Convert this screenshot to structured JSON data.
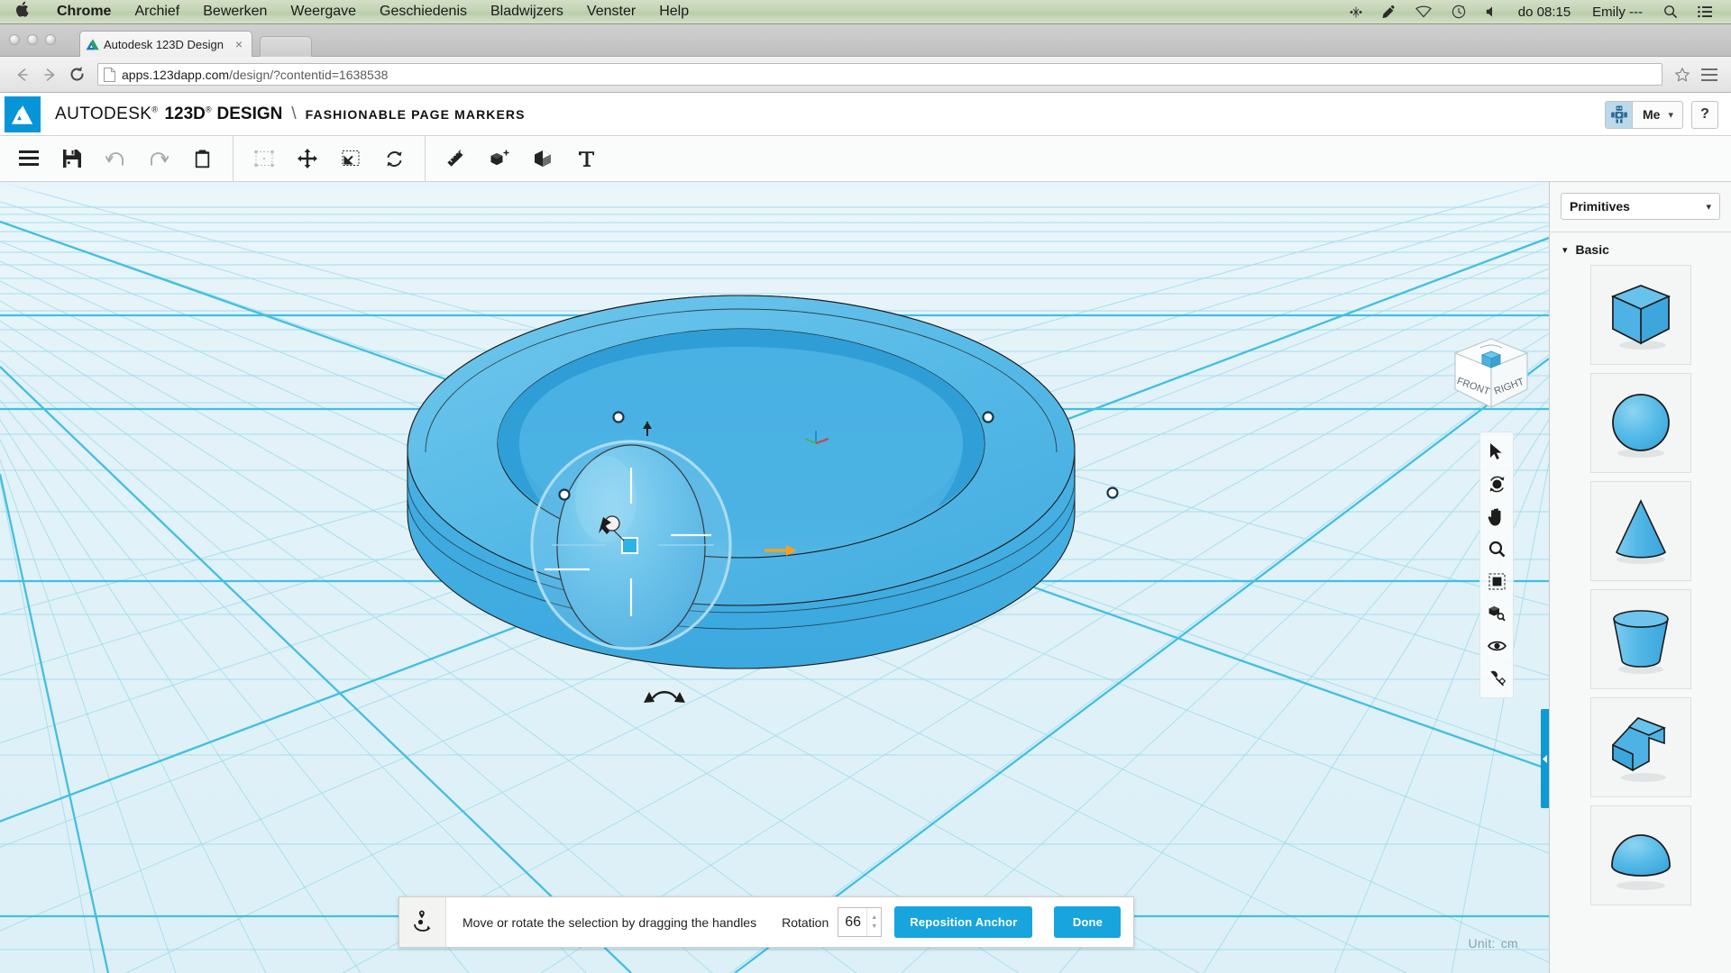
{
  "macmenu": {
    "apple_icon": "apple-icon",
    "items": [
      "Chrome",
      "Archief",
      "Bewerken",
      "Weergave",
      "Geschiedenis",
      "Bladwijzers",
      "Venster",
      "Help"
    ],
    "status": {
      "icons": [
        "bluetooth-icon",
        "pen-icon",
        "wifi-icon",
        "timemachine-icon",
        "volume-icon"
      ],
      "clock": "do 08:15",
      "user": "Emily ---",
      "search_icon": "search-icon",
      "notifications_icon": "list-icon"
    }
  },
  "browser": {
    "tab": {
      "title": "Autodesk 123D Design",
      "close_icon": "close-icon",
      "favicon": "autodesk-favicon"
    },
    "nav": {
      "back_icon": "arrow-left-icon",
      "forward_icon": "arrow-right-icon",
      "reload_icon": "reload-icon"
    },
    "omnibox": {
      "page_icon": "page-icon",
      "url_host": "apps.123dapp.com",
      "url_path": "/design/?contentid=1638538",
      "star_icon": "star-icon"
    },
    "menu_icon": "hamburger-menu-icon"
  },
  "app_header": {
    "logo": "autodesk-logo",
    "brand_autodesk": "AUTODESK",
    "brand_123d": "123D",
    "brand_design": "DESIGN",
    "separator": "\\",
    "document_title": "FASHIONABLE PAGE MARKERS",
    "me_label": "Me",
    "me_chevron": "chevron-down-icon",
    "avatar_icon": "robot-avatar-icon",
    "help_label": "?"
  },
  "toolbar": {
    "groups": [
      [
        {
          "name": "menu-icon",
          "label": "Menu"
        },
        {
          "name": "save-icon",
          "label": "Save"
        },
        {
          "name": "undo-icon",
          "label": "Undo"
        },
        {
          "name": "redo-icon",
          "label": "Redo"
        },
        {
          "name": "paste-icon",
          "label": "Paste"
        }
      ],
      [
        {
          "name": "select-icon",
          "label": "Select"
        },
        {
          "name": "move-icon",
          "label": "Move"
        },
        {
          "name": "scale-icon",
          "label": "Scale"
        },
        {
          "name": "transform-icon",
          "label": "Transform"
        }
      ],
      [
        {
          "name": "measure-icon",
          "label": "Measure"
        },
        {
          "name": "primitives-icon",
          "label": "Primitives"
        },
        {
          "name": "combine-icon",
          "label": "Combine"
        },
        {
          "name": "text-icon",
          "label": "Text"
        }
      ]
    ]
  },
  "viewport": {
    "viewcube": {
      "front_label": "FRONT",
      "right_label": "RIGHT",
      "home_icon": "home-cube-icon"
    },
    "nav_tools": [
      "cursor-icon",
      "orbit-icon",
      "pan-icon",
      "zoom-icon",
      "fit-view-icon",
      "zoom-object-icon",
      "visibility-icon",
      "materials-icon"
    ],
    "unit_label": "Unit:",
    "unit_value": "cm",
    "panel_handle": "panel-collapse-handle",
    "model_colors": {
      "object_fill": "#4cb3e4",
      "object_light": "#6cc4ec",
      "object_dark": "#2e9ad4",
      "grid_bg": "#e4f3f8",
      "grid_line": "#8ed6ea",
      "grid_major": "#29b6dd",
      "gizmo_ring": "#9fd9f0",
      "gizmo_accent": "#f59b1c"
    }
  },
  "statusbar": {
    "icon": "rotate-anchor-icon",
    "message": "Move or rotate the selection by dragging the handles",
    "rotation_label": "Rotation",
    "rotation_value": "66",
    "spinner_up": "spinner-up-icon",
    "spinner_down": "spinner-down-icon",
    "reposition_label": "Reposition Anchor",
    "done_label": "Done",
    "button_color": "#18a4dd"
  },
  "right_panel": {
    "category_select": "Primitives",
    "category_chevron": "chevron-down-icon",
    "section_label": "Basic",
    "section_chevron": "chevron-down-icon",
    "shapes": [
      {
        "name": "box-primitive",
        "label": "Box"
      },
      {
        "name": "sphere-primitive",
        "label": "Sphere"
      },
      {
        "name": "cone-primitive",
        "label": "Cone"
      },
      {
        "name": "cylinder-primitive",
        "label": "Cylinder"
      },
      {
        "name": "wedge-primitive",
        "label": "Wedge"
      },
      {
        "name": "hemisphere-primitive",
        "label": "Hemisphere"
      }
    ]
  }
}
